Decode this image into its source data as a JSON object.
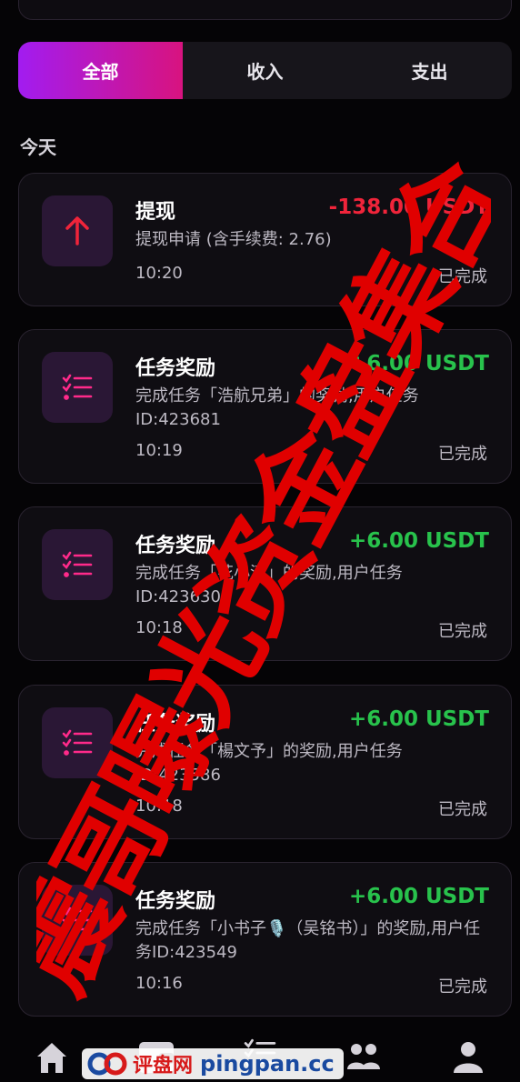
{
  "tabs": [
    {
      "label": "全部",
      "active": true
    },
    {
      "label": "收入",
      "active": false
    },
    {
      "label": "支出",
      "active": false
    }
  ],
  "section_title": "今天",
  "transactions": [
    {
      "icon": "arrow-up-icon",
      "title": "提现",
      "amount": "-138.00 USDT",
      "type": "negative",
      "desc": "提现申请 (含手续费: 2.76)",
      "time": "10:20",
      "status": "已完成"
    },
    {
      "icon": "task-list-icon",
      "title": "任务奖励",
      "amount": "+6.00 USDT",
      "type": "positive",
      "desc": "完成任务「浩航兄弟」的奖励,用户任务ID:423681",
      "time": "10:19",
      "status": "已完成"
    },
    {
      "icon": "task-list-icon",
      "title": "任务奖励",
      "amount": "+6.00 USDT",
      "type": "positive",
      "desc": "完成任务「花小清」的奖励,用户任务ID:423630",
      "time": "10:18",
      "status": "已完成"
    },
    {
      "icon": "task-list-icon",
      "title": "任务奖励",
      "amount": "+6.00 USDT",
      "type": "positive",
      "desc": "完成任务「楊文予」的奖励,用户任务ID:423586",
      "time": "10:18",
      "status": "已完成"
    },
    {
      "icon": "task-list-icon",
      "title": "任务奖励",
      "amount": "+6.00 USDT",
      "type": "positive",
      "desc": "完成任务「小书子🎙️（吴铭书）」的奖励,用户任务ID:423549",
      "time": "10:16",
      "status": "已完成"
    }
  ],
  "bottom_nav": [
    {
      "icon": "home-icon"
    },
    {
      "icon": "wallet-icon"
    },
    {
      "icon": "task-list-icon"
    },
    {
      "icon": "team-icon"
    },
    {
      "icon": "profile-icon"
    }
  ],
  "watermark": {
    "text": "评盘网",
    "url": "pingpan.cc"
  },
  "stamp_text": "震哥曝光资金盘集合",
  "colors": {
    "accent_start": "#a21cf0",
    "accent_end": "#d8137f",
    "negative": "#f0243a",
    "positive": "#28c24c",
    "stamp": "#e00000"
  }
}
